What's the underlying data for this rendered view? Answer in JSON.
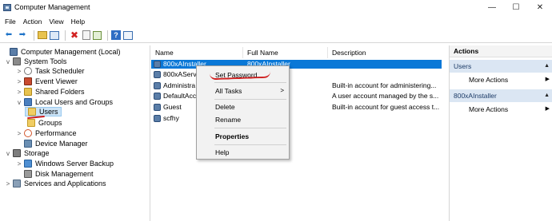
{
  "window": {
    "title": "Computer Management",
    "controls": {
      "minimize": "—",
      "maximize": "☐",
      "close": "✕"
    }
  },
  "menu": [
    "File",
    "Action",
    "View",
    "Help"
  ],
  "toolbar": {
    "icons": [
      "back-arrow-icon",
      "forward-arrow-icon",
      "up-folder-icon",
      "show-hide-tree-icon",
      "delete-icon",
      "properties-icon",
      "export-list-icon",
      "help-icon",
      "show-hide-action-pane-icon"
    ]
  },
  "tree": {
    "items": [
      {
        "label": "Computer Management (Local)",
        "chevron": "",
        "icon": "computer-icon",
        "level": 0
      },
      {
        "label": "System Tools",
        "chevron": "v",
        "icon": "tools-icon",
        "level": 1
      },
      {
        "label": "Task Scheduler",
        "chevron": ">",
        "icon": "clock-icon",
        "level": 2
      },
      {
        "label": "Event Viewer",
        "chevron": ">",
        "icon": "event-log-icon",
        "level": 2
      },
      {
        "label": "Shared Folders",
        "chevron": ">",
        "icon": "shared-folder-icon",
        "level": 2
      },
      {
        "label": "Local Users and Groups",
        "chevron": "v",
        "icon": "users-icon",
        "level": 2
      },
      {
        "label": "Users",
        "chevron": "",
        "icon": "folder-icon",
        "level": 3,
        "selected": true
      },
      {
        "label": "Groups",
        "chevron": "",
        "icon": "folder-icon",
        "level": 3
      },
      {
        "label": "Performance",
        "chevron": ">",
        "icon": "performance-icon",
        "level": 2
      },
      {
        "label": "Device Manager",
        "chevron": "",
        "icon": "device-manager-icon",
        "level": 2
      },
      {
        "label": "Storage",
        "chevron": "v",
        "icon": "storage-icon",
        "level": 1
      },
      {
        "label": "Windows Server Backup",
        "chevron": ">",
        "icon": "backup-icon",
        "level": 2
      },
      {
        "label": "Disk Management",
        "chevron": "",
        "icon": "disk-icon",
        "level": 2
      },
      {
        "label": "Services and Applications",
        "chevron": ">",
        "icon": "services-icon",
        "level": 1
      }
    ]
  },
  "list": {
    "columns": [
      "Name",
      "Full Name",
      "Description"
    ],
    "rows": [
      {
        "name": "800xAInstaller",
        "full_name": "800xAInstaller",
        "description": "",
        "selected": true
      },
      {
        "name": "800xAServ",
        "full_name": "",
        "description": ""
      },
      {
        "name": "Administra",
        "full_name": "",
        "description": "Built-in account for administering..."
      },
      {
        "name": "DefaultAcc",
        "full_name": "",
        "description": "A user account managed by the s..."
      },
      {
        "name": "Guest",
        "full_name": "",
        "description": "Built-in account for guest access t..."
      },
      {
        "name": "scfhy",
        "full_name": "",
        "description": ""
      }
    ]
  },
  "context_menu": {
    "items": [
      {
        "label": "Set Password...",
        "bold": false,
        "submenu": false
      },
      {
        "label": "All Tasks",
        "bold": false,
        "submenu": true,
        "arrow": ">"
      },
      {
        "label": "Delete",
        "bold": false,
        "submenu": false
      },
      {
        "label": "Rename",
        "bold": false,
        "submenu": false
      },
      {
        "label": "Properties",
        "bold": true,
        "submenu": false
      },
      {
        "label": "Help",
        "bold": false,
        "submenu": false
      }
    ]
  },
  "actions": {
    "header": "Actions",
    "sections": [
      {
        "title": "Users",
        "items": [
          {
            "label": "More Actions",
            "arrow": "▶"
          }
        ],
        "caret": "▲"
      },
      {
        "title": "800xAInstaller",
        "items": [
          {
            "label": "More Actions",
            "arrow": "▶"
          }
        ],
        "caret": "▲"
      }
    ]
  },
  "colors": {
    "selection_blue": "#0a78d7",
    "tree_selection": "#cce4f7",
    "annotation_red": "#d01e1e",
    "actions_section_bg": "#dbe6f3"
  }
}
